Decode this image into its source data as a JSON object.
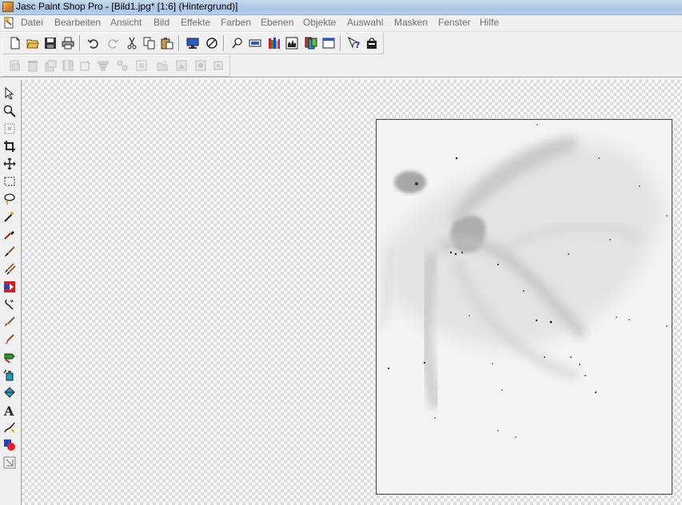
{
  "window": {
    "title": "Jasc Paint Shop Pro - [Bild1.jpg* [1:6] (Hintergrund)]"
  },
  "menu": {
    "items": [
      {
        "label": "Datei"
      },
      {
        "label": "Bearbeiten"
      },
      {
        "label": "Ansicht"
      },
      {
        "label": "Bild"
      },
      {
        "label": "Effekte"
      },
      {
        "label": "Farben"
      },
      {
        "label": "Ebenen"
      },
      {
        "label": "Objekte"
      },
      {
        "label": "Auswahl"
      },
      {
        "label": "Masken"
      },
      {
        "label": "Fenster"
      },
      {
        "label": "Hilfe"
      }
    ]
  },
  "toolbar_standard": [
    "new-file-icon",
    "open-folder-icon",
    "save-icon",
    "print-icon",
    "undo-icon",
    "redo-icon",
    "cut-icon",
    "copy-icon",
    "paste-icon",
    "browse-icon",
    "zoom-icon",
    "overview-icon",
    "toolbar-toggle-icon",
    "histogram-icon",
    "color-palette-icon",
    "layer-palette-icon",
    "status-bar-icon",
    "help-icon",
    "shop-icon"
  ],
  "toolbar_web": [
    "web-tool-1-icon",
    "web-tool-2-icon",
    "web-tool-3-icon",
    "web-tool-4-icon",
    "web-tool-5-icon",
    "web-tool-6-icon",
    "web-tool-7-icon",
    "web-tool-8-icon",
    "web-tool-9-icon",
    "web-tool-10-icon",
    "web-tool-11-icon"
  ],
  "tools": [
    "arrow-icon",
    "zoom-tool-icon",
    "deform-icon",
    "crop-icon",
    "mover-icon",
    "selection-icon",
    "freehand-selection-icon",
    "magic-wand-icon",
    "dropper-icon",
    "paintbrush-icon",
    "clone-brush-icon",
    "color-replacer-icon",
    "retouch-icon",
    "scratch-remover-icon",
    "eraser-icon",
    "picture-tube-icon",
    "airbrush-icon",
    "flood-fill-icon",
    "text-icon",
    "draw-icon",
    "preset-shapes-icon",
    "object-selector-icon"
  ],
  "colors": {
    "menu_text_disabled": "#707070",
    "canvas_border": "#404040",
    "workspace_checker": "#dcdcdc"
  }
}
